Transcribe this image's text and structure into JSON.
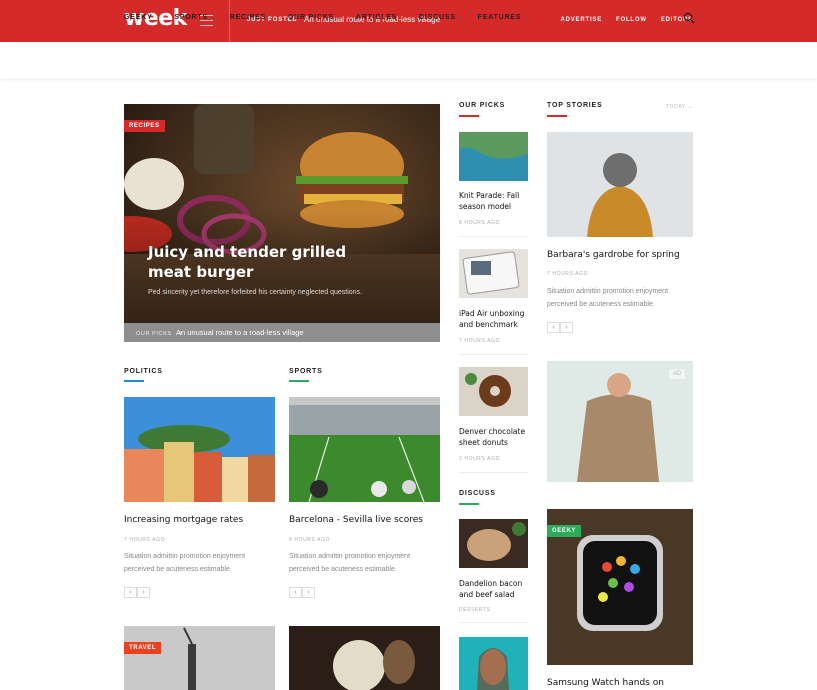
{
  "header": {
    "logo": "week",
    "just_posted_label": "JUST POSTED",
    "just_posted_text": "An unusual route to a road-less village",
    "links": [
      "ADVERTISE",
      "FOLLOW",
      "EDITORS"
    ]
  },
  "nav": {
    "items": [
      "GEEKY",
      "SPORTS",
      "RECIPES",
      "OUR PICKS",
      "ARTICLES",
      "DISCUSS",
      "FEATURES"
    ]
  },
  "hero": {
    "badge": "RECIPES",
    "title": "Juicy and tender grilled meat burger",
    "subtitle": "Ped sincerity yet therefore forfeited his certainty neglected questions.",
    "breadcrumb_label": "OUR PICKS",
    "breadcrumb_sep": "›",
    "breadcrumb_text": "An unusual route to a road-less village"
  },
  "politics": {
    "section": "POLITICS",
    "title": "Increasing mortgage rates",
    "meta": "7 HOURS AGO",
    "excerpt": "Situation admittin promotion enjoyment perceived be acuteness estimable."
  },
  "sports": {
    "section": "SPORTS",
    "title": "Barcelona - Sevilla live scores",
    "meta": "8 HOURS AGO",
    "excerpt": "Situation admittin promotion enjoyment perceived be acuteness estimable."
  },
  "bottom": {
    "travel_badge": "TRAVEL"
  },
  "our_picks": {
    "section": "OUR PICKS",
    "items": [
      {
        "title": "Knit Parade: Fall season model",
        "meta": "8 HOURS AGO"
      },
      {
        "title": "iPad Air unboxing and benchmark",
        "meta": "7 HOURS AGO"
      },
      {
        "title": "Denver chocolate sheet donuts",
        "meta": "3 HOURS AGO"
      }
    ]
  },
  "discuss": {
    "section": "DISCUSS",
    "items": [
      {
        "title": "Dandelion bacon and beef salad",
        "meta": "DESSERTS"
      }
    ]
  },
  "top_stories": {
    "section": "TOP STORIES",
    "filter": "TODAY",
    "title": "Barbara's gardrobe for spring",
    "meta": "7 HOURS AGO",
    "excerpt": "Situation admittin promotion enjoyment perceived be acuteness estimable.",
    "ad_label": "AD",
    "geeky_badge": "GEEKY",
    "watch_title": "Samsung Watch hands on"
  },
  "pager": {
    "prev": "‹",
    "next": "›"
  },
  "colors": {
    "brand_red": "#d42a2a",
    "politics": "#1e8fd6",
    "sports": "#2daa5a",
    "geeky": "#2daa5a",
    "travel": "#e8421f"
  }
}
